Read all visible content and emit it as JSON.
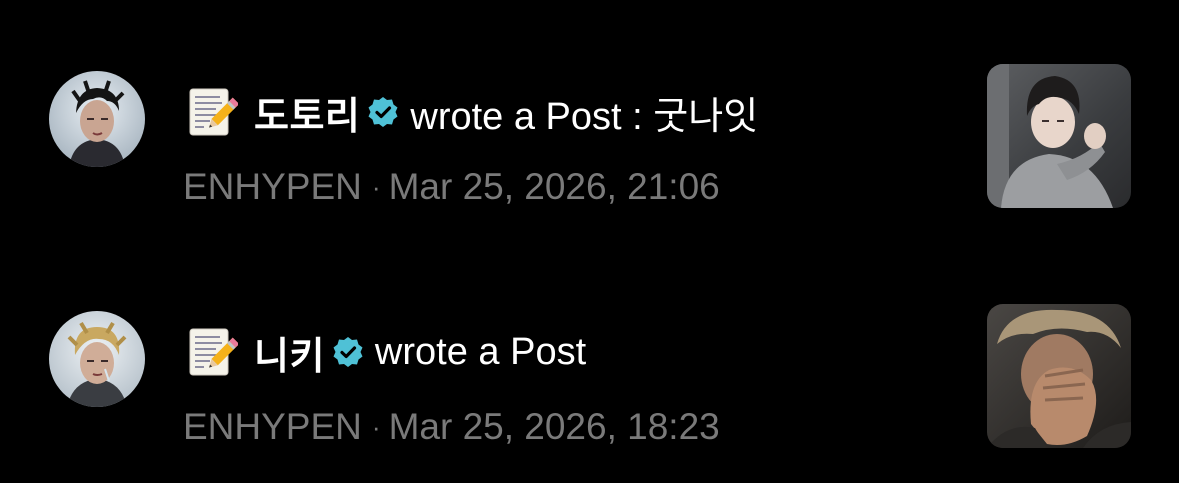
{
  "notifications": [
    {
      "author": "도토리",
      "action": "wrote a Post : 굿나잇",
      "community": "ENHYPEN",
      "separator": "·",
      "timestamp": "Mar 25, 2026, 21:06",
      "icon": "memo-pencil-icon",
      "verified_icon": "verified-badge-icon"
    },
    {
      "author": "니키",
      "action": "wrote a Post",
      "community": "ENHYPEN",
      "separator": "·",
      "timestamp": "Mar 25, 2026, 18:23",
      "icon": "memo-pencil-icon",
      "verified_icon": "verified-badge-icon"
    }
  ],
  "colors": {
    "background": "#000000",
    "primary_text": "#ffffff",
    "secondary_text": "#7a7a7a",
    "verified_badge": "#4fc1d6"
  }
}
